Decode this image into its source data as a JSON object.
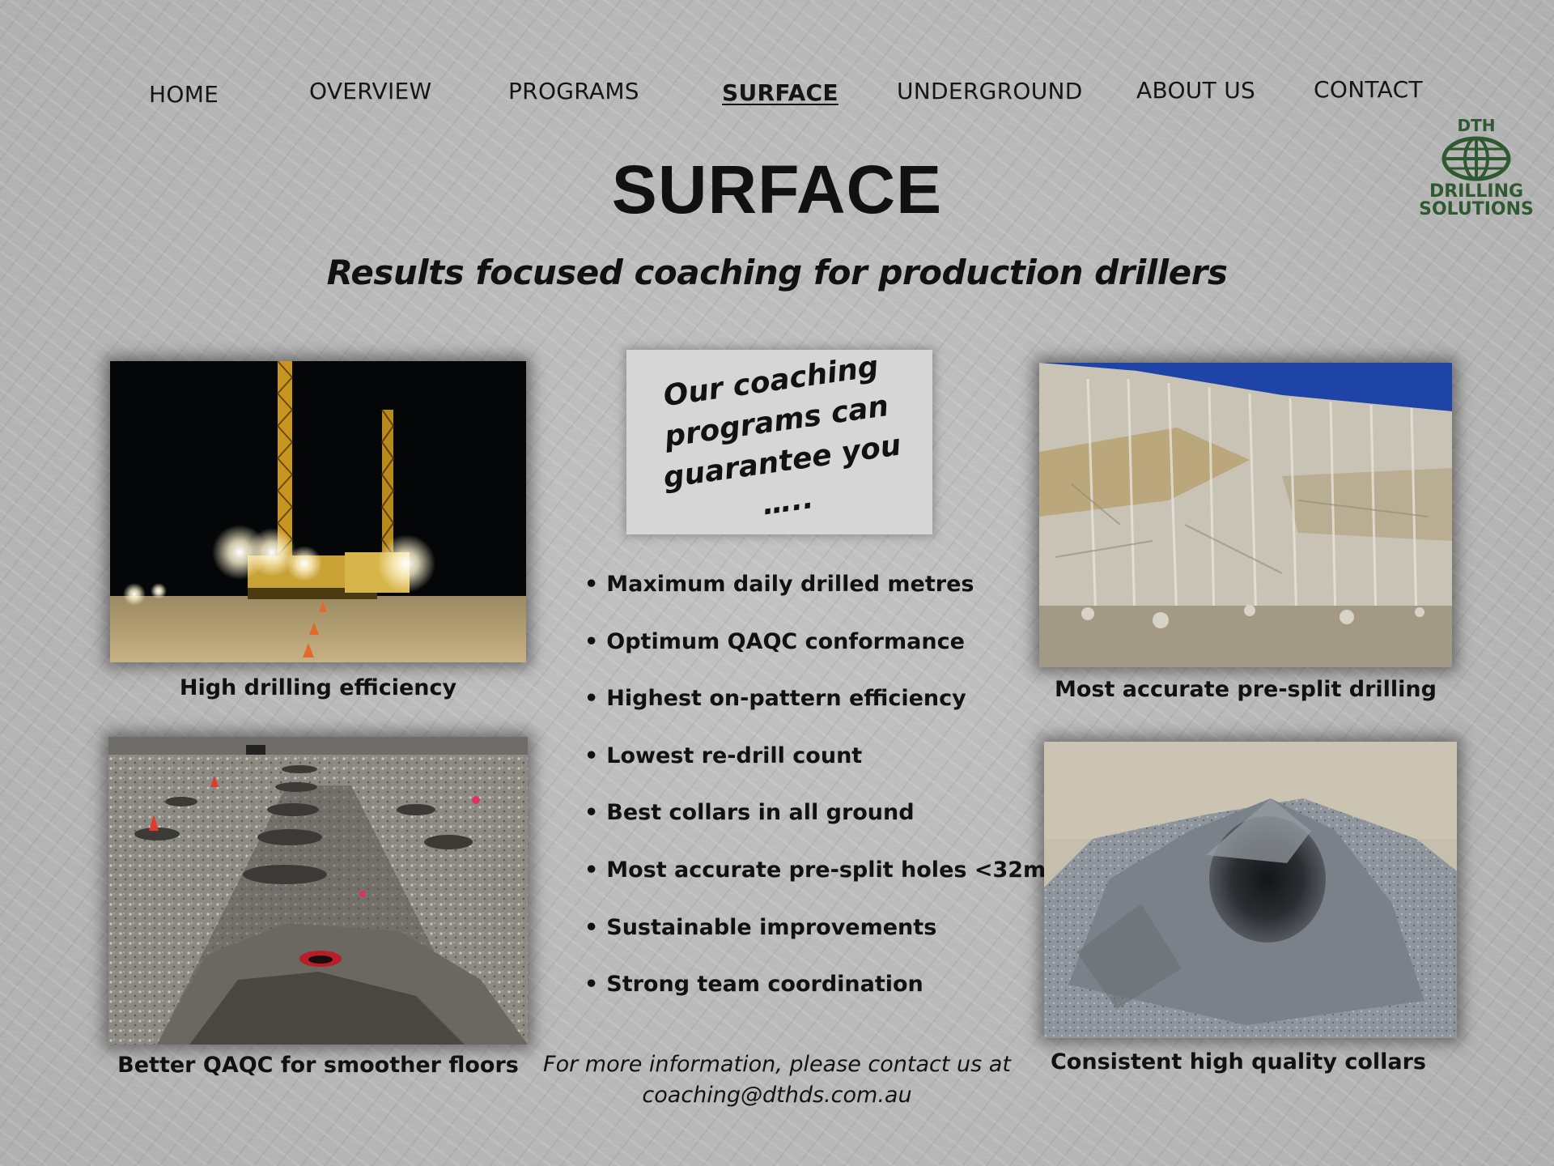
{
  "nav": {
    "items": [
      {
        "label": "HOME",
        "active": false
      },
      {
        "label": "OVERVIEW",
        "active": false
      },
      {
        "label": "PROGRAMS",
        "active": false
      },
      {
        "label": "SURFACE",
        "active": true
      },
      {
        "label": "UNDERGROUND",
        "active": false
      },
      {
        "label": "ABOUT US",
        "active": false
      },
      {
        "label": "CONTACT",
        "active": false
      }
    ]
  },
  "logo": {
    "line1": "DTH",
    "line2": "DRILLING",
    "line3": "SOLUTIONS",
    "icon": "globe-icon",
    "color": "#2f5a31"
  },
  "page": {
    "title": "SURFACE",
    "subtitle": "Results focused coaching for production drillers"
  },
  "callout": {
    "text": "Our coaching\nprograms can\nguarantee you ….."
  },
  "bullets": [
    "Maximum daily drilled metres",
    "Optimum QAQC conformance",
    "Highest on-pattern efficiency",
    "Lowest re-drill count",
    "Best collars in all ground",
    "Most accurate pre-split holes <32m",
    "Sustainable improvements",
    "Strong team coordination"
  ],
  "photos": [
    {
      "caption": "High drilling efficiency",
      "scene": "night-drill-rigs"
    },
    {
      "caption": "Most accurate pre-split drilling",
      "scene": "pre-split-rock-wall"
    },
    {
      "caption": "Better QAQC for smoother floors",
      "scene": "drill-pattern-floor"
    },
    {
      "caption": "Consistent high quality collars",
      "scene": "drill-hole-collar"
    }
  ],
  "contact": {
    "line1": "For more information, please contact us at",
    "line2": "coaching@dthds.com.au"
  },
  "colors": {
    "background": "#b9b9b9",
    "text": "#111111",
    "logo_green": "#2f5a31",
    "callout_bg": "#d6d6d6"
  }
}
